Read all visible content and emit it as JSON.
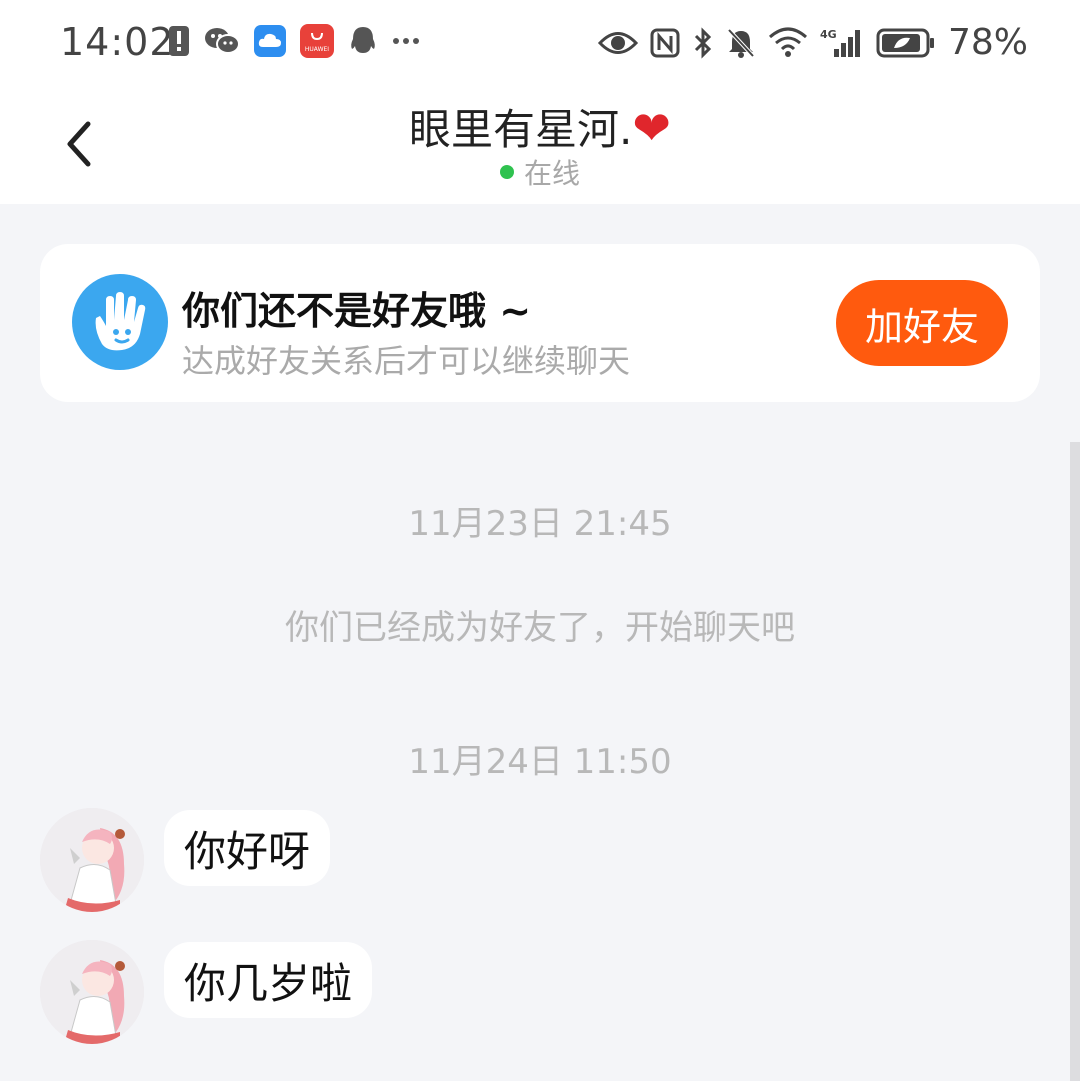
{
  "status_bar": {
    "time": "14:02",
    "battery_percent": "78%",
    "left_icons": [
      "sim-alert-icon",
      "wechat-icon",
      "cloud-icon",
      "huawei-store-icon",
      "qq-icon",
      "more-dots-icon"
    ],
    "right_icons": [
      "eye-icon",
      "nfc-icon",
      "bluetooth-icon",
      "mute-bell-icon",
      "wifi-icon",
      "signal-4g-icon",
      "battery-icon"
    ],
    "network_label": "4G",
    "store_label": "HUAWEI"
  },
  "header": {
    "title": "眼里有星河.",
    "title_emoji": "❤",
    "status": "在线",
    "status_color": "#2fc24f"
  },
  "friend_card": {
    "title": "你们还不是好友哦 ~",
    "subtitle": "达成好友关系后才可以继续聊天",
    "add_button": "加好友",
    "button_color": "#ff5a0e",
    "icon_color": "#3ba7ef"
  },
  "chat": {
    "timestamp_1": "11月23日 21:45",
    "system_message": "你们已经成为好友了，开始聊天吧",
    "timestamp_2": "11月24日 11:50",
    "messages": [
      {
        "text": "你好呀"
      },
      {
        "text": "你几岁啦"
      }
    ]
  }
}
